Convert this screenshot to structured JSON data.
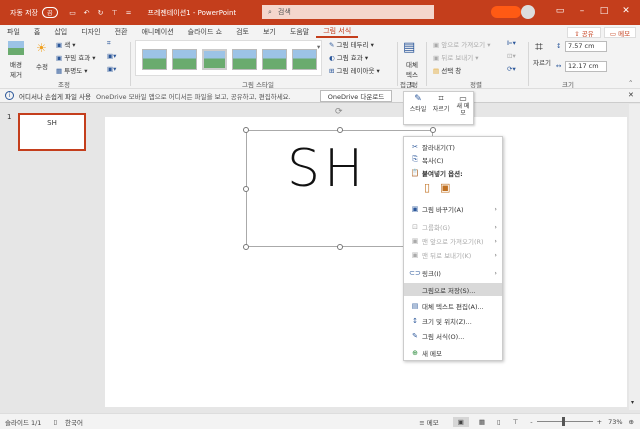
{
  "titlebar": {
    "autosave": "자동 저장",
    "autosave_state": "끔",
    "doc_title": "프레젠테이션1 - PowerPoint",
    "search_placeholder": "검색"
  },
  "tabs": [
    "파일",
    "홈",
    "삽입",
    "디자인",
    "전환",
    "애니메이션",
    "슬라이드 쇼",
    "검토",
    "보기",
    "도움말",
    "그림 서식"
  ],
  "active_tab": "그림 서식",
  "share": "공유",
  "comments": "메모",
  "ribbon": {
    "adjust": {
      "remove_bg": "배경 제거",
      "corrections": "수정",
      "color": "색",
      "artistic": "꾸밈 효과",
      "transparency": "투명도",
      "label": "조정"
    },
    "styles": {
      "border": "그림 테두리",
      "effects": "그림 효과",
      "layout": "그림 레이아웃",
      "label": "그림 스타일"
    },
    "access": {
      "alt_text": "대체 텍스트",
      "label": "접근성"
    },
    "arrange": {
      "bring_forward": "앞으로 가져오기",
      "send_backward": "뒤로 보내기",
      "selection_pane": "선택 창",
      "label": "정렬"
    },
    "size": {
      "crop": "자르기",
      "height": "7.57 cm",
      "width": "12.17 cm",
      "label": "크기"
    }
  },
  "infobar": {
    "title": "어디서나 손쉽게 파일 사용",
    "message": "OneDrive 모바일 앱으로 어디서든 파일을 보고, 공유하고, 편집하세요.",
    "button": "OneDrive 다운로드"
  },
  "thumbnail": {
    "number": "1",
    "text": "SH"
  },
  "slide_text": "SH",
  "mini_toolbar": {
    "style": "스타일",
    "crop": "자르기",
    "new_comment": "새 메모"
  },
  "context_menu": [
    {
      "icon": "cut",
      "label": "잘라내기(T)"
    },
    {
      "icon": "copy",
      "label": "복사(C)"
    },
    {
      "icon": "paste",
      "label": "붙여넣기 옵션:"
    },
    {
      "icon": "change-picture",
      "label": "그림 바꾸기(A)",
      "sub": true
    },
    {
      "icon": "group",
      "label": "그룹화(G)",
      "sub": true,
      "disabled": true
    },
    {
      "icon": "bring-front",
      "label": "맨 앞으로 가져오기(R)",
      "sub": true,
      "disabled": true
    },
    {
      "icon": "send-back",
      "label": "맨 뒤로 보내기(K)",
      "sub": true,
      "disabled": true
    },
    {
      "icon": "link",
      "label": "링크(I)",
      "sub": true
    },
    {
      "icon": "",
      "label": "그림으로 저장(S)...",
      "highlight": true
    },
    {
      "icon": "alt-text",
      "label": "대체 텍스트 편집(A)..."
    },
    {
      "icon": "size",
      "label": "크기 및 위치(Z)..."
    },
    {
      "icon": "format",
      "label": "그림 서식(O)..."
    },
    {
      "icon": "comment",
      "label": "새 메모"
    }
  ],
  "statusbar": {
    "slide": "슬라이드 1/1",
    "language": "한국어",
    "notes": "메모",
    "zoom": "73%",
    "zoom_fraction": 0.45
  }
}
